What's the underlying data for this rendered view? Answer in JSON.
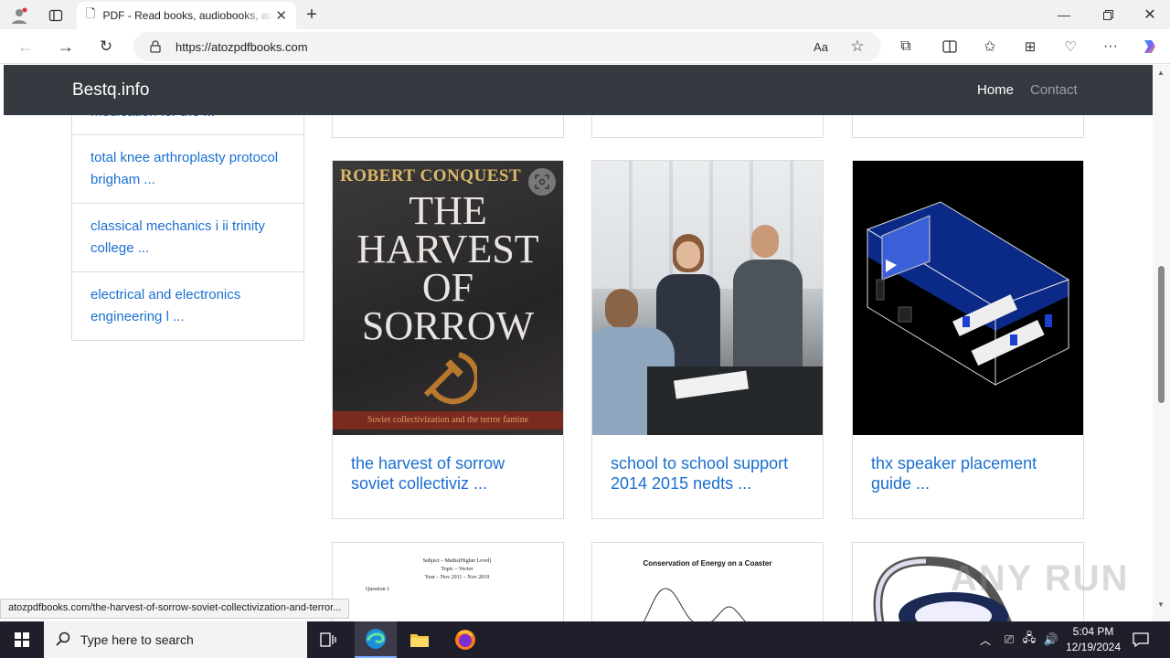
{
  "browser": {
    "tab_title": "PDF - Read books, audiobooks, and more",
    "url": "https://atozpdfbooks.com",
    "status_url": "atozpdfbooks.com/the-harvest-of-sorrow-soviet-collectivization-and-terror..."
  },
  "site": {
    "brand": "Bestq.info",
    "nav": [
      "Home",
      "Contact"
    ]
  },
  "sidebar": {
    "partial": "medication for the ...",
    "items": [
      "total knee arthroplasty protocol brigham ...",
      "classical mechanics i ii trinity college ...",
      "electrical and electronics engineering l ..."
    ]
  },
  "cards": [
    {
      "title": "the harvest of sorrow soviet collectiviz ...",
      "cover_author": "ROBERT CONQUEST",
      "cover_title": [
        "THE",
        "HARVEST",
        "OF",
        "SORROW"
      ],
      "cover_subtitle": "Soviet collectivization and the terror famine"
    },
    {
      "title": "school to school support 2014 2015 nedts ..."
    },
    {
      "title": "thx speaker placement guide ..."
    }
  ],
  "bottom_cards": {
    "math_title": "Subject – Maths(Higher Level)",
    "math_topic": "Topic – Vector",
    "math_year": "Year – Nov 2011 – Nov 2019",
    "math_q": "Question 1",
    "coaster_title": "Conservation of Energy on a Coaster"
  },
  "watermark": "ANY RUN",
  "taskbar": {
    "search_placeholder": "Type here to search",
    "time": "5:04 PM",
    "date": "12/19/2024"
  },
  "colors": {
    "navbar": "#343a40",
    "link": "#1a6fd1",
    "taskbar": "#1f1f2b"
  }
}
